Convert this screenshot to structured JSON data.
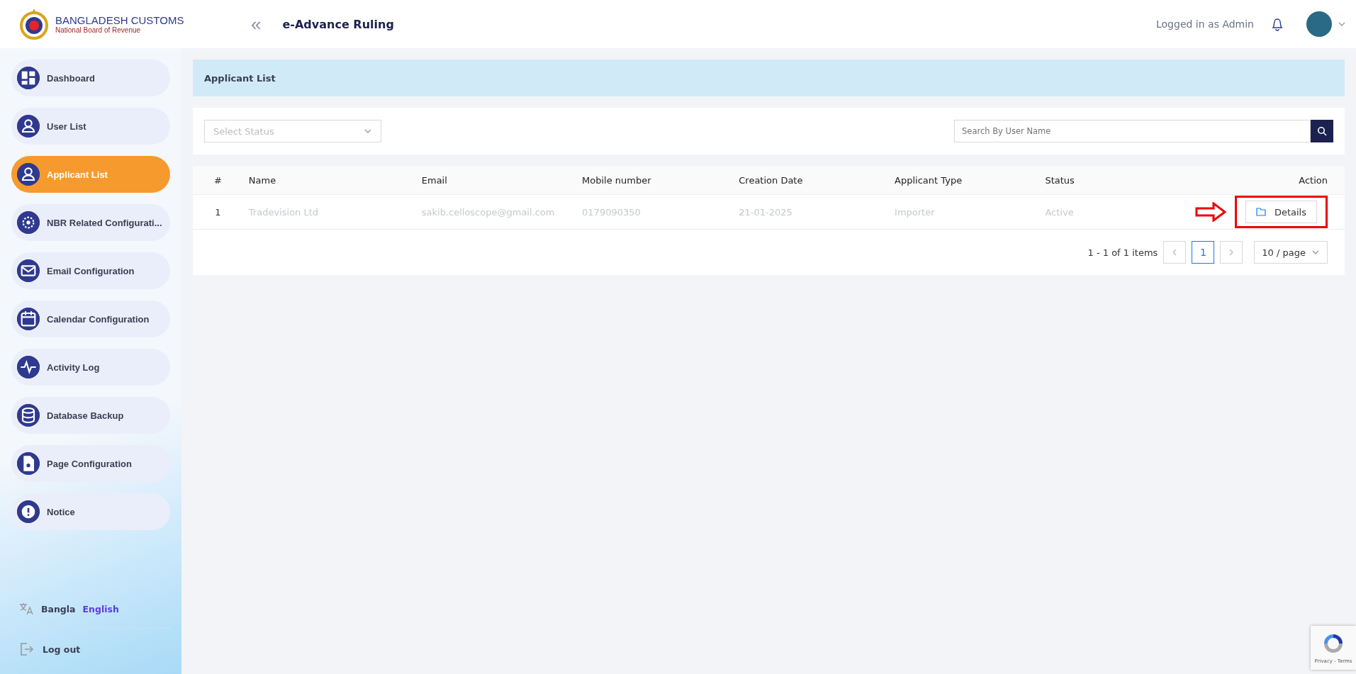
{
  "header": {
    "brand_title": "BANGLADESH CUSTOMS",
    "brand_subtitle": "National Board of Revenue",
    "collapse_icon": "«",
    "app_title": "e-Advance Ruling",
    "user_label": "Logged in as Admin"
  },
  "sidebar": {
    "items": [
      {
        "label": "Dashboard",
        "selected": false
      },
      {
        "label": "User List",
        "selected": false
      },
      {
        "label": "Applicant List",
        "selected": true
      },
      {
        "label": "NBR Related Configurati...",
        "selected": false
      },
      {
        "label": "Email Configuration",
        "selected": false
      },
      {
        "label": "Calendar Configuration",
        "selected": false
      },
      {
        "label": "Activity Log",
        "selected": false
      },
      {
        "label": "Database Backup",
        "selected": false
      },
      {
        "label": "Page Configuration",
        "selected": false
      },
      {
        "label": "Notice",
        "selected": false
      }
    ],
    "languages": [
      {
        "label": "Bangla",
        "selected": false
      },
      {
        "label": "English",
        "selected": true
      }
    ],
    "logout": "Log out"
  },
  "page_title": "Applicant List",
  "filters": {
    "status_placeholder": "Select Status",
    "search_placeholder": "Search By User Name"
  },
  "table": {
    "columns": [
      "#",
      "Name",
      "Email",
      "Mobile number",
      "Creation Date",
      "Applicant Type",
      "Status",
      "Action"
    ],
    "rows": [
      {
        "cells": [
          "1",
          "Tradevision Ltd",
          "sakib.celloscope@gmail.com",
          "0179090350",
          "21-01-2025",
          "Importer",
          "Active"
        ],
        "action": "Details",
        "highlighted": true
      }
    ]
  },
  "pagination": {
    "summary": "1 - 1 of 1 items",
    "pages": [
      {
        "label": "1",
        "selected": true
      }
    ],
    "page_size": "10 / page"
  },
  "recaptcha": {
    "text": "Privacy - Terms"
  }
}
